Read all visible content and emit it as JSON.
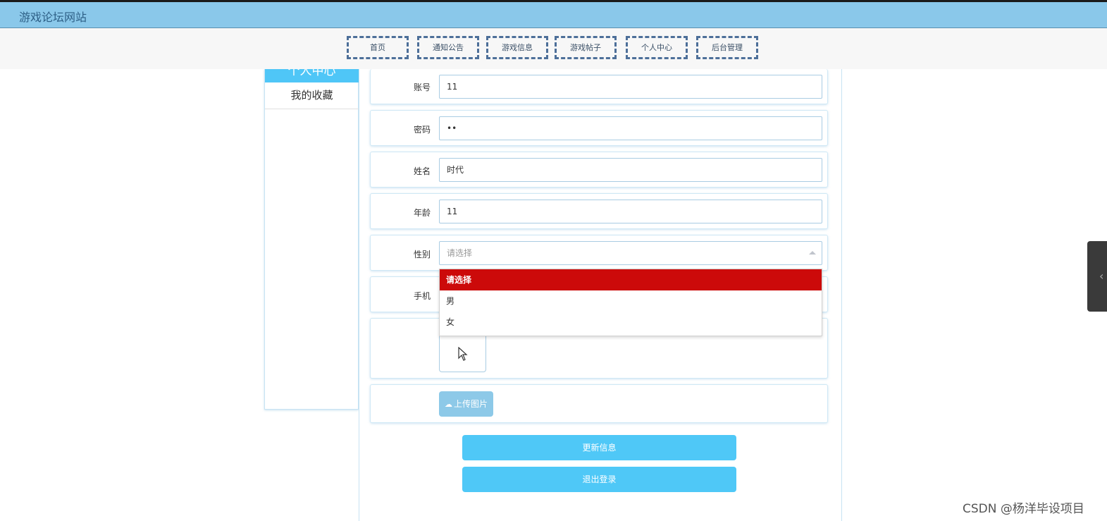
{
  "site": {
    "title": "游戏论坛网站"
  },
  "nav": {
    "items": [
      {
        "label": "首页"
      },
      {
        "label": "通知公告"
      },
      {
        "label": "游戏信息"
      },
      {
        "label": "游戏帖子"
      },
      {
        "label": "个人中心"
      },
      {
        "label": "后台管理"
      }
    ]
  },
  "sidebar": {
    "active_label": "个人中心",
    "favorites_label": "我的收藏"
  },
  "form": {
    "account": {
      "label": "账号",
      "value": "11"
    },
    "password": {
      "label": "密码",
      "value": "••"
    },
    "name": {
      "label": "姓名",
      "value": "时代"
    },
    "age": {
      "label": "年龄",
      "value": "11"
    },
    "gender": {
      "label": "性别",
      "placeholder": "请选择",
      "options": [
        "请选择",
        "男",
        "女"
      ],
      "highlighted": "请选择"
    },
    "phone": {
      "label": "手机"
    },
    "upload_label": "上传图片",
    "update_label": "更新信息",
    "logout_label": "退出登录"
  },
  "watermark": "CSDN @杨洋毕设项目",
  "colors": {
    "header_bg": "#8ac8ea",
    "accent": "#4fc8f7",
    "option_highlight": "#cc0a0a",
    "nav_border": "#4d6f99"
  }
}
